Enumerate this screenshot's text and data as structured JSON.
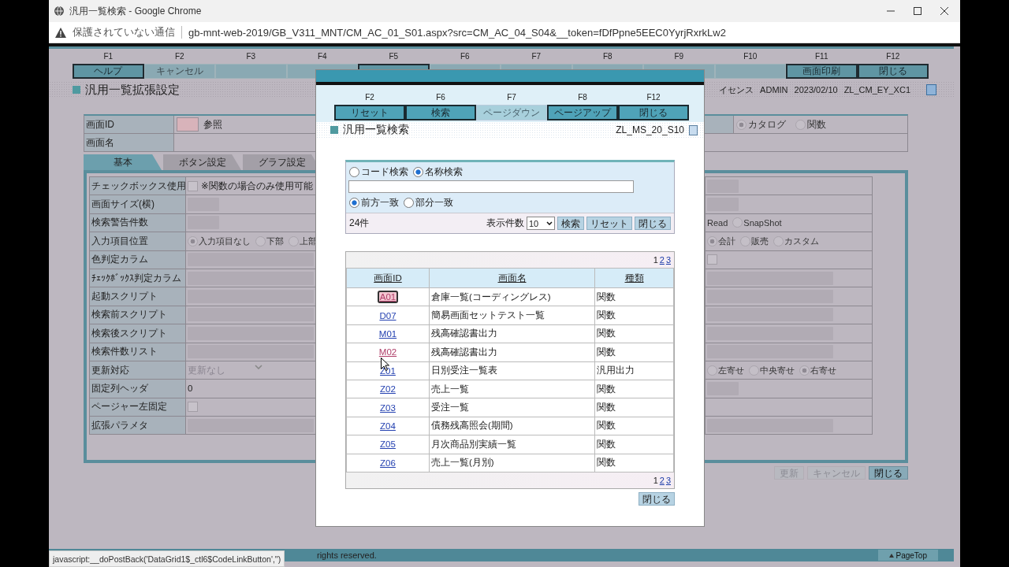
{
  "window": {
    "title": "汎用一覧検索 - Google Chrome"
  },
  "address_bar": {
    "security": "保護されていない通信",
    "url": "gb-mnt-web-2019/GB_V311_MNT/CM_AC_01_S01.aspx?src=CM_AC_04_S04&__token=fDfPpne5EEC0YyrjRxrkLw2"
  },
  "function_keys": [
    {
      "key": "F1",
      "label": "ヘルプ",
      "enabled": true
    },
    {
      "key": "F2",
      "label": "キャンセル",
      "enabled": false
    },
    {
      "key": "F3",
      "enabled": false
    },
    {
      "key": "F4",
      "enabled": false
    },
    {
      "key": "F5",
      "enabled": true
    },
    {
      "key": "F6",
      "enabled": false
    },
    {
      "key": "F7",
      "enabled": false
    },
    {
      "key": "F8",
      "enabled": false
    },
    {
      "key": "F9",
      "enabled": false
    },
    {
      "key": "F10",
      "enabled": false
    },
    {
      "key": "F11",
      "label": "画面印刷",
      "enabled": true
    },
    {
      "key": "F12",
      "label": "閉じる",
      "enabled": true
    }
  ],
  "page_header": {
    "title": "汎用一覧拡張設定",
    "license": "イセンス",
    "user": "ADMIN",
    "date": "2023/02/10",
    "screen_code": "ZL_CM_EY_XC1"
  },
  "header_form": {
    "screen_id_label": "画面ID",
    "reference": "参照",
    "screen_name_label": "画面名",
    "type_options": [
      {
        "label": "カタログ",
        "selected": true
      },
      {
        "label": "関数",
        "selected": false
      }
    ]
  },
  "tabs": [
    {
      "label": "基本",
      "selected": true
    },
    {
      "label": "ボタン設定",
      "selected": false
    },
    {
      "label": "グラフ設定",
      "selected": false
    }
  ],
  "settings_rows": [
    {
      "label": "チェックボックス使用",
      "left": {
        "kind": "checkbox",
        "checked": false,
        "text": "※関数の場合のみ使用可能"
      },
      "right": {
        "kind": "short-field"
      }
    },
    {
      "label": "画面サイズ(横)",
      "left": {
        "kind": "short-field"
      },
      "right": {
        "kind": "short-field"
      }
    },
    {
      "label": "検索警告件数",
      "left": {
        "kind": "short-field"
      },
      "right": {
        "kind": "radios",
        "options": [
          {
            "label": "Read"
          },
          {
            "label": "SnapShot",
            "selected": false
          }
        ]
      }
    },
    {
      "label": "入力項目位置",
      "left": {
        "kind": "radios",
        "options": [
          {
            "label": "入力項目なし",
            "selected": true
          },
          {
            "label": "下部",
            "selected": false
          },
          {
            "label": "上部",
            "selected": false
          }
        ]
      },
      "right": {
        "kind": "radios",
        "options": [
          {
            "label": "会計",
            "selected": true
          },
          {
            "label": "販売",
            "selected": false
          },
          {
            "label": "カスタム",
            "selected": false
          }
        ]
      }
    },
    {
      "label": "色判定カラム",
      "left": {
        "kind": "field"
      },
      "right": {
        "kind": "checkbox",
        "checked": false
      }
    },
    {
      "label": "ﾁｪｯｸﾎﾞｯｸｽ判定カラム",
      "left": {
        "kind": "field"
      },
      "right": {
        "kind": "field"
      }
    },
    {
      "label": "起動スクリプト",
      "left": {
        "kind": "field"
      },
      "right": {
        "kind": "field"
      }
    },
    {
      "label": "検索前スクリプト",
      "left": {
        "kind": "field"
      },
      "right": {
        "kind": "field"
      }
    },
    {
      "label": "検索後スクリプト",
      "left": {
        "kind": "field"
      },
      "right": {
        "kind": "field"
      }
    },
    {
      "label": "検索件数リスト",
      "left": {
        "kind": "field"
      },
      "right": {
        "kind": "field"
      }
    },
    {
      "label": "更新対応",
      "left": {
        "kind": "select",
        "value": "更新なし"
      },
      "right": {
        "kind": "radios",
        "options": [
          {
            "label": "左寄せ",
            "selected": false
          },
          {
            "label": "中央寄せ",
            "selected": false
          },
          {
            "label": "右寄せ",
            "selected": true
          }
        ]
      }
    },
    {
      "label": "固定列ヘッダ",
      "left": {
        "kind": "text",
        "value": "0"
      },
      "right": {
        "kind": "short-field"
      }
    },
    {
      "label": "ページャー左固定",
      "left": {
        "kind": "checkbox",
        "checked": false
      },
      "right": {
        "kind": "none"
      }
    },
    {
      "label": "拡張パラメタ",
      "left": {
        "kind": "field"
      },
      "right": {
        "kind": "field"
      }
    }
  ],
  "footer_buttons": [
    {
      "label": "更新",
      "enabled": false
    },
    {
      "label": "キャンセル",
      "enabled": false
    },
    {
      "label": "閉じる",
      "enabled": true
    }
  ],
  "footer": {
    "copyright": "rights reserved.",
    "page_top": "PageTop"
  },
  "status_url": "javascript:__doPostBack('DataGrid1$_ctl6$CodeLinkButton','')",
  "dialog": {
    "function_keys": [
      {
        "key": "F2",
        "label": "リセット",
        "enabled": true
      },
      {
        "key": "F6",
        "label": "検索",
        "enabled": true
      },
      {
        "key": "F7",
        "label": "ページダウン",
        "enabled": false
      },
      {
        "key": "F8",
        "label": "ページアップ",
        "enabled": true
      },
      {
        "key": "F12",
        "label": "閉じる",
        "enabled": true
      }
    ],
    "title": "汎用一覧検索",
    "screen_code": "ZL_MS_20_S10",
    "search_modes": [
      {
        "label": "コード検索",
        "selected": false
      },
      {
        "label": "名称検索",
        "selected": true
      }
    ],
    "match_modes": [
      {
        "label": "前方一致",
        "selected": true
      },
      {
        "label": "部分一致",
        "selected": false
      }
    ],
    "count": "24件",
    "page_size_label": "表示件数",
    "page_size": "10",
    "buttons": [
      "検索",
      "リセット",
      "閉じる"
    ],
    "pager_top": [
      {
        "label": "1",
        "selected": true
      },
      {
        "label": "2",
        "selected": false
      },
      {
        "label": "3",
        "selected": false
      }
    ],
    "columns": [
      "画面ID",
      "画面名",
      "種類"
    ],
    "rows": [
      {
        "id": "A01",
        "name": "倉庫一覧(コーディングレス)",
        "type": "関数",
        "visited": true,
        "focused": true
      },
      {
        "id": "D07",
        "name": "簡易画面セットテスト一覧",
        "type": "関数",
        "visited": false,
        "focused": false
      },
      {
        "id": "M01",
        "name": "残高確認書出力",
        "type": "関数",
        "visited": false,
        "focused": false
      },
      {
        "id": "M02",
        "name": "残高確認書出力",
        "type": "関数",
        "visited": true,
        "focused": false
      },
      {
        "id": "Z01",
        "name": "日別受注一覧表",
        "type": "汎用出力",
        "visited": false,
        "focused": false
      },
      {
        "id": "Z02",
        "name": "売上一覧",
        "type": "関数",
        "visited": false,
        "focused": false
      },
      {
        "id": "Z03",
        "name": "受注一覧",
        "type": "関数",
        "visited": false,
        "focused": false
      },
      {
        "id": "Z04",
        "name": "債務残高照会(期間)",
        "type": "関数",
        "visited": false,
        "focused": false
      },
      {
        "id": "Z05",
        "name": "月次商品別実績一覧",
        "type": "関数",
        "visited": false,
        "focused": false
      },
      {
        "id": "Z06",
        "name": "売上一覧(月別)",
        "type": "関数",
        "visited": false,
        "focused": false
      }
    ],
    "pager_bottom": [
      {
        "label": "1",
        "selected": true
      },
      {
        "label": "2",
        "selected": false
      },
      {
        "label": "3",
        "selected": false
      }
    ],
    "close_button": "閉じる"
  }
}
